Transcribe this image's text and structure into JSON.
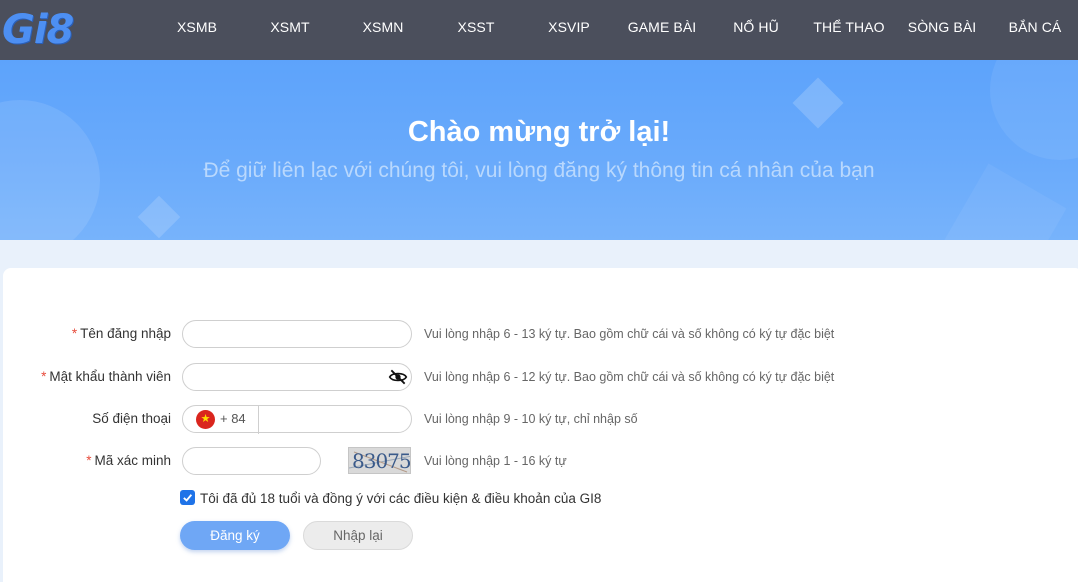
{
  "logo": {
    "text": "Gi8"
  },
  "nav": [
    "XSMB",
    "XSMT",
    "XSMN",
    "XSST",
    "XSVIP",
    "GAME BÀI",
    "NỔ HŨ",
    "THỂ THAO",
    "SÒNG BÀI",
    "BẮN CÁ"
  ],
  "banner": {
    "title": "Chào mừng trở lại!",
    "subtitle": "Để giữ liên lạc với chúng tôi, vui lòng đăng ký thông tin cá nhân của bạn"
  },
  "form": {
    "username": {
      "label": "Tên đăng nhập",
      "required_mark": "*",
      "value": "",
      "hint": "Vui lòng nhập 6 - 13 ký tự. Bao gồm chữ cái và số không có ký tự đặc biệt"
    },
    "password": {
      "label": "Mật khẩu thành viên",
      "required_mark": "*",
      "value": "",
      "hint": "Vui lòng nhập 6 - 12 ký tự. Bao gồm chữ cái và số không có ký tự đặc biệt",
      "icon": "eye-slash-icon"
    },
    "phone": {
      "label": "Số điện thoại",
      "country_code": "+ 84",
      "flag_icon": "vietnam-flag-icon",
      "value": "",
      "hint": "Vui lòng nhập 9 - 10 ký tự, chỉ nhập số"
    },
    "captcha": {
      "label": "Mã xác minh",
      "required_mark": "*",
      "value": "",
      "image_text": "83075",
      "hint": "Vui lòng nhập 1 - 16 ký tự"
    },
    "agree": {
      "checked": true,
      "text": "Tôi đã đủ 18 tuổi và đồng ý với các điều kiện & điều khoản của GI8"
    },
    "submit_label": "Đăng ký",
    "reset_label": "Nhập lại"
  },
  "colors": {
    "nav_bg": "#4b4f5c",
    "banner": "#69aafb",
    "primary_button": "#6fa7f5",
    "required": "#e74c3c",
    "checkbox": "#1f73e8"
  }
}
